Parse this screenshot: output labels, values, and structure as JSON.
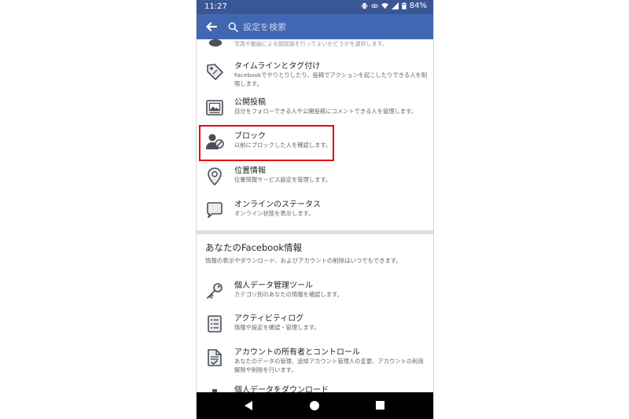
{
  "status_bar": {
    "time": "11:27",
    "battery": "84%"
  },
  "app_bar": {
    "search_placeholder": "設定を検索"
  },
  "top_partial": {
    "text": "写真や動画による顔認識を行ってよいかどうかを選択します。"
  },
  "settings_rows": [
    {
      "title": "タイムラインとタグ付け",
      "desc": "Facebookでやりとりしたり、投稿でアクションを起こしたりできる人を制限します。",
      "icon": "tag-icon"
    },
    {
      "title": "公開投稿",
      "desc": "自分をフォローできる人や公開投稿にコメントできる人を管理します。",
      "icon": "public-post-icon"
    },
    {
      "title": "ブロック",
      "desc": "以前にブロックした人を確認します。",
      "icon": "block-user-icon"
    },
    {
      "title": "位置情報",
      "desc": "位置情報サービス設定を管理します。",
      "icon": "location-pin-icon"
    },
    {
      "title": "オンラインのステータス",
      "desc": "オンライン状態を表示します。",
      "icon": "chat-bubble-icon"
    }
  ],
  "info_section": {
    "title": "あなたのFacebook情報",
    "subtitle": "情報の表示やダウンロード、およびアカウントの削除はいつでもできます。"
  },
  "info_rows": [
    {
      "title": "個人データ管理ツール",
      "desc": "カテゴリ別のあなたの情報を確認します。",
      "icon": "key-icon"
    },
    {
      "title": "アクティビティログ",
      "desc": "情報や設定を確認・管理します。",
      "icon": "activity-log-icon"
    },
    {
      "title": "アカウントの所有者とコントロール",
      "desc": "あなたのデータの管理、追悼アカウント管理人の変更、アカウントの利用解除や削除を行います。",
      "icon": "document-check-icon"
    },
    {
      "title": "個人データをダウンロード",
      "desc": "",
      "icon": "download-icon"
    }
  ],
  "colors": {
    "status_bar": "#3a5795",
    "app_bar": "#4267b2",
    "highlight": "#e60012",
    "icon": "#4b4f56",
    "icon_fill": "#e9ebee"
  }
}
